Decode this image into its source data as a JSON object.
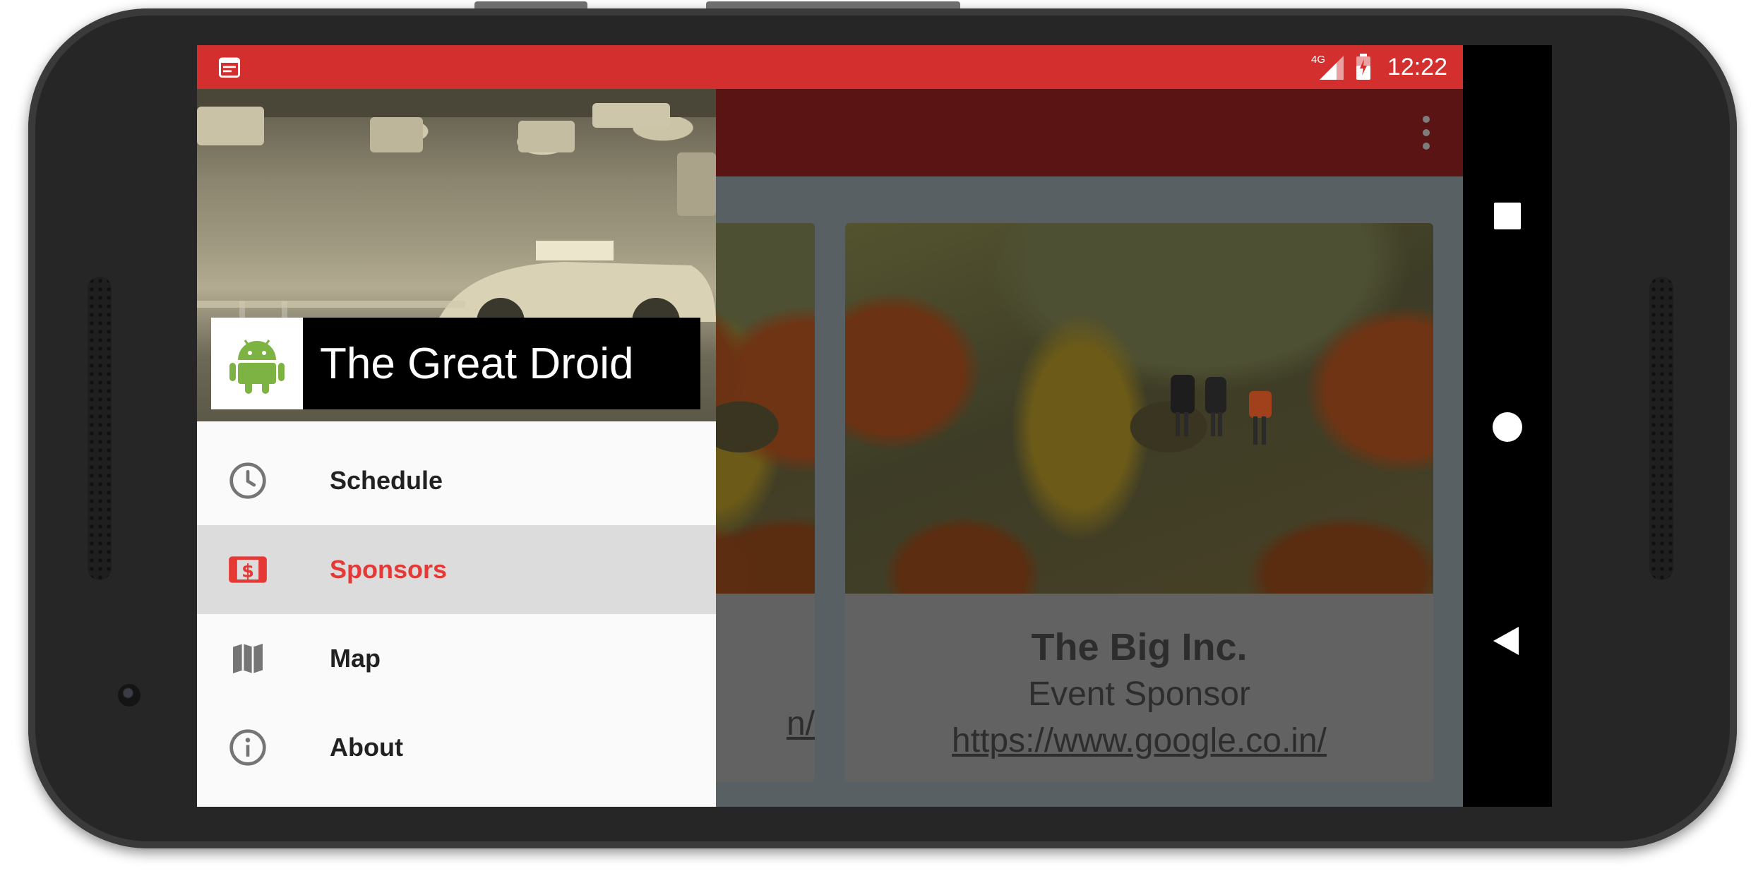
{
  "status_bar": {
    "network": "4G",
    "time": "12:22",
    "color": "#d32f2f"
  },
  "toolbar": {
    "color": "#5a1414",
    "overflow_icon": "more-vert-icon"
  },
  "sponsor_cards": [
    {
      "name": "",
      "role": "",
      "link_partial": "n/"
    },
    {
      "name": "The Big Inc.",
      "role": "Event Sponsor",
      "link": "https://www.google.co.in/"
    }
  ],
  "drawer": {
    "header_title": "The Great Droid",
    "avatar_icon": "android-icon",
    "items": [
      {
        "label": "Schedule",
        "icon": "clock-icon",
        "selected": false
      },
      {
        "label": "Sponsors",
        "icon": "money-icon",
        "selected": true
      },
      {
        "label": "Map",
        "icon": "map-icon",
        "selected": false
      },
      {
        "label": "About",
        "icon": "info-icon",
        "selected": false
      }
    ],
    "accent_color": "#e53935"
  },
  "nav_bar": {
    "buttons": [
      "recents-icon",
      "home-icon",
      "back-icon"
    ]
  }
}
